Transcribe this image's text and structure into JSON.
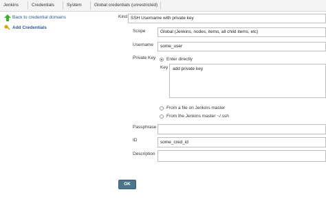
{
  "breadcrumb": [
    {
      "label": "Jenkins"
    },
    {
      "label": "Credentials"
    },
    {
      "label": "System"
    },
    {
      "label": "Global credentials (unrestricted)"
    }
  ],
  "sidebar": {
    "items": [
      {
        "label": "Back to credential domains",
        "icon": "up-arrow-icon"
      },
      {
        "label": "Add Credentials",
        "icon": "key-icon"
      }
    ]
  },
  "form": {
    "kind": {
      "label": "Kind",
      "value": "SSH Username with private key"
    },
    "scope": {
      "label": "Scope",
      "value": "Global (Jenkins, nodes, items, all child items, etc)"
    },
    "username": {
      "label": "Username",
      "value": "some_user"
    },
    "private_key": {
      "label": "Private Key",
      "options": [
        {
          "label": "Enter directly",
          "selected": true
        },
        {
          "label": "From a file on Jenkins master",
          "selected": false
        },
        {
          "label": "From the Jenkins master ~/.ssh",
          "selected": false
        }
      ],
      "key_label": "Key",
      "key_value": "add private key"
    },
    "passphrase": {
      "label": "Passphrase",
      "value": ""
    },
    "id": {
      "label": "ID",
      "value": "some_cred_id"
    },
    "description": {
      "label": "Description",
      "value": ""
    },
    "submit_label": "OK"
  },
  "colors": {
    "link": "#2b5797",
    "button": "#4b758b",
    "breadcrumb_bg": "#f4f4f4"
  }
}
